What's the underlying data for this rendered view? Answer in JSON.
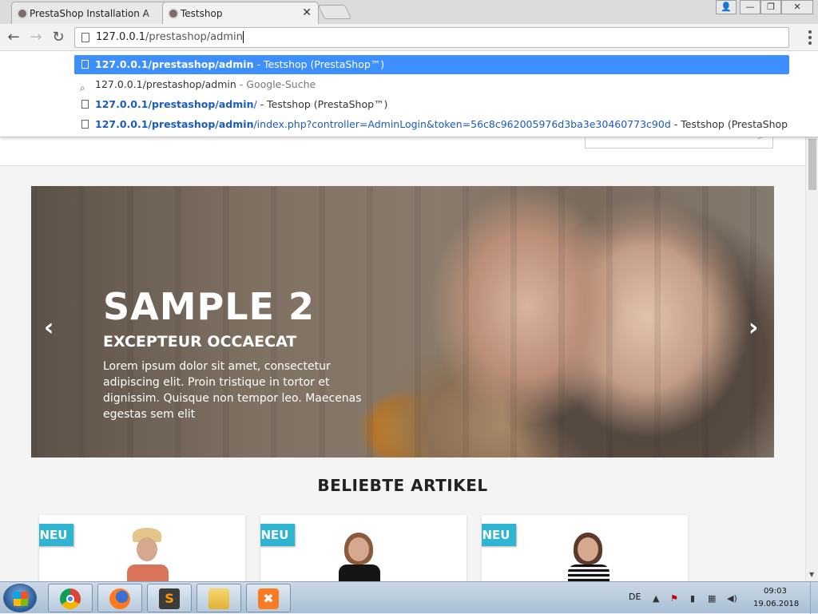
{
  "browser": {
    "tabs": [
      {
        "title": "PrestaShop Installation A",
        "active": false
      },
      {
        "title": "Testshop",
        "active": true
      }
    ],
    "window_controls": {
      "user": "👤",
      "minimize": "—",
      "restore": "❐",
      "close": "✕"
    },
    "address": {
      "host": "127.0.0.1",
      "path": "/prestashop/admin"
    },
    "suggestions": [
      {
        "url_bold": "127.0.0.1/prestashop/admin",
        "url_rest": "",
        "sep": " - ",
        "title": "Testshop (PrestaShop™)",
        "type": "page",
        "selected": true
      },
      {
        "url_bold": "",
        "url_rest": "127.0.0.1/prestashop/admin",
        "sep": " - ",
        "title": "Google-Suche",
        "type": "search",
        "selected": false
      },
      {
        "url_bold": "127.0.0.1/prestashop/admin",
        "url_rest": "/",
        "sep": " - ",
        "title": "Testshop (PrestaShop™)",
        "type": "page",
        "selected": false
      },
      {
        "url_bold": "127.0.0.1/prestashop/admin",
        "url_rest": "/index.php?controller=AdminLogin&token=56c8c962005976d3ba3e30460773c90d",
        "sep": " - ",
        "title": "Testshop (PrestaShop™)",
        "type": "page",
        "selected": false
      }
    ]
  },
  "page": {
    "slider": {
      "title": "SAMPLE 2",
      "subtitle": "EXCEPTEUR OCCAECAT",
      "text": "Lorem ipsum dolor sit amet, consectetur adipiscing elit. Proin tristique in tortor et dignissim. Quisque non tempor leo. Maecenas egestas sem elit",
      "prev": "‹",
      "next": "›"
    },
    "section_title": "BELIEBTE ARTIKEL",
    "products": [
      {
        "badge": "NEU"
      },
      {
        "badge": "NEU"
      },
      {
        "badge": "NEU"
      }
    ]
  },
  "taskbar": {
    "items": [
      "chrome-icon",
      "firefox-icon",
      "sublime-icon",
      "explorer-icon",
      "xampp-icon"
    ],
    "language": "DE",
    "time": "09:03",
    "date": "19.06.2018"
  },
  "colors": {
    "accent": "#3d8fff",
    "badge": "#2fb5d2",
    "link": "#1b5bc2"
  }
}
